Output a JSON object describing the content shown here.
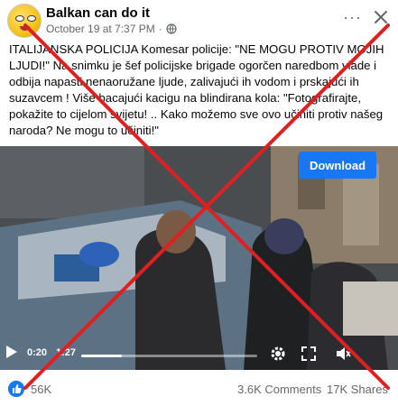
{
  "post": {
    "page_name": "Balkan can do it",
    "date": "October 19 at 7:37 PM",
    "separator": "·",
    "caption": "ITALIJANSKA POLICIJA Komesar policije: \"NE MOGU PROTIV MOJIH LJUDI!\" Na snimku je šef policijske brigade ogorčen naredbom vlade i odbija napasti nenaoružane ljude, zalivajući ih vodom i prskajući ih suzavcem !  Više bacajući kacigu na blindirana kola: \"Fotografirajte, pokažite to cijelom svijetu! .. Kako možemo sve ovo učiniti protiv našeg naroda? Ne mogu to učiniti!\"",
    "more_icon": "more-dots-icon",
    "close_icon": "close-icon"
  },
  "video": {
    "download_label": "Download",
    "current_time": "0:20",
    "duration": "1:27",
    "progress": 0.23
  },
  "stats": {
    "likes": "56K",
    "comments": "3.6K Comments",
    "shares": "17K Shares"
  },
  "overlay": {
    "cross_color": "#e02020"
  },
  "colors": {
    "accent": "#1877f2",
    "muted": "#65676b"
  }
}
